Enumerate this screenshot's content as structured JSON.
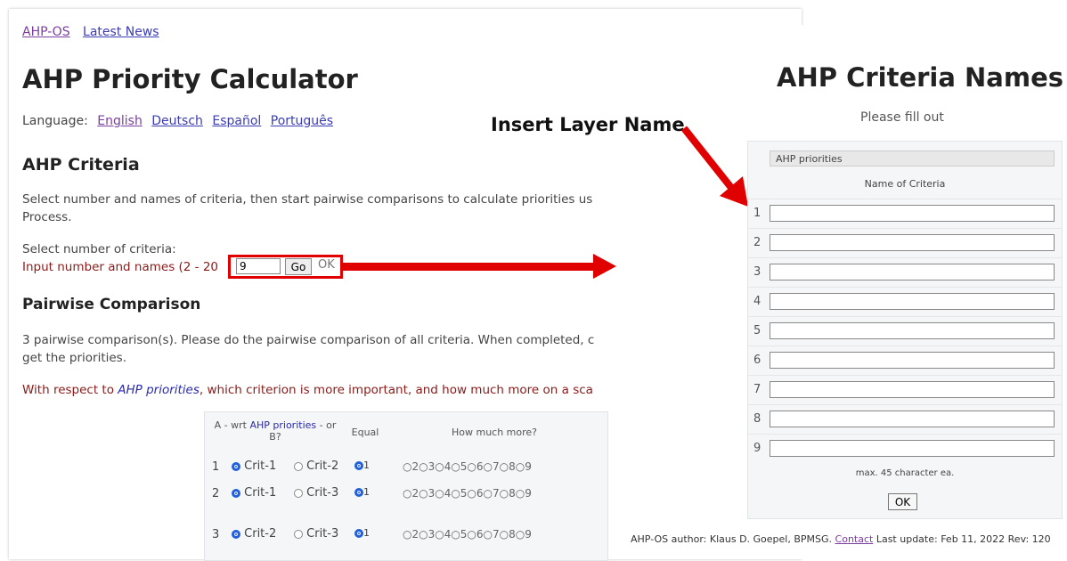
{
  "nav": {
    "link1": "AHP-OS",
    "link2": "Latest News"
  },
  "main": {
    "title": "AHP Priority Calculator",
    "language_label": "Language:",
    "languages": [
      "English",
      "Deutsch",
      "Español",
      "Português"
    ],
    "criteria_heading": "AHP Criteria",
    "criteria_desc_line1": "Select number and names of criteria, then start pairwise comparisons to calculate priorities us",
    "criteria_desc_line2": "Process.",
    "select_label": "Select number of criteria:",
    "input_label": "Input number and names (2 - 20",
    "input_value": "9",
    "go_label": "Go",
    "ok_label": "OK",
    "pairwise_heading": "Pairwise Comparison",
    "pairwise_desc_line1": "3 pairwise comparison(s). Please do the pairwise comparison of all criteria. When completed, c",
    "pairwise_desc_line2": "get the priorities.",
    "respect_prefix": "With respect to ",
    "respect_topic": "AHP priorities",
    "respect_suffix": ", which criterion is more important, and how much more on a sca"
  },
  "comparison": {
    "head_a": "A - wrt ",
    "head_topic": "AHP priorities",
    "head_b": " - or",
    "head_b2": "B?",
    "head_equal": "Equal",
    "head_more": "How much more?",
    "rows": [
      {
        "num": "1",
        "a": "Crit-1",
        "b": "Crit-2",
        "equal": "1",
        "scale": "2 3 4 5 6 7 8 9"
      },
      {
        "num": "2",
        "a": "Crit-1",
        "b": "Crit-3",
        "equal": "1",
        "scale": "2 3 4 5 6 7 8 9"
      },
      {
        "num": "3",
        "a": "Crit-2",
        "b": "Crit-3",
        "equal": "1",
        "scale": "2 3 4 5 6 7 8 9"
      }
    ]
  },
  "annotation": {
    "insert_label": "Insert Layer Name",
    "arrow_color": "#e00000"
  },
  "criteria_names": {
    "title": "AHP Criteria Names",
    "subtitle": "Please fill out",
    "layer_value": "AHP priorities",
    "column_header": "Name of Criteria",
    "row_numbers": [
      "1",
      "2",
      "3",
      "4",
      "5",
      "6",
      "7",
      "8",
      "9"
    ],
    "max_note": "max. 45 character ea.",
    "ok_label": "OK"
  },
  "footer": {
    "prefix": "AHP-OS author: Klaus D. Goepel, BPMSG. ",
    "contact": "Contact",
    "suffix": " Last update: Feb 11, 2022 Rev: 120"
  }
}
